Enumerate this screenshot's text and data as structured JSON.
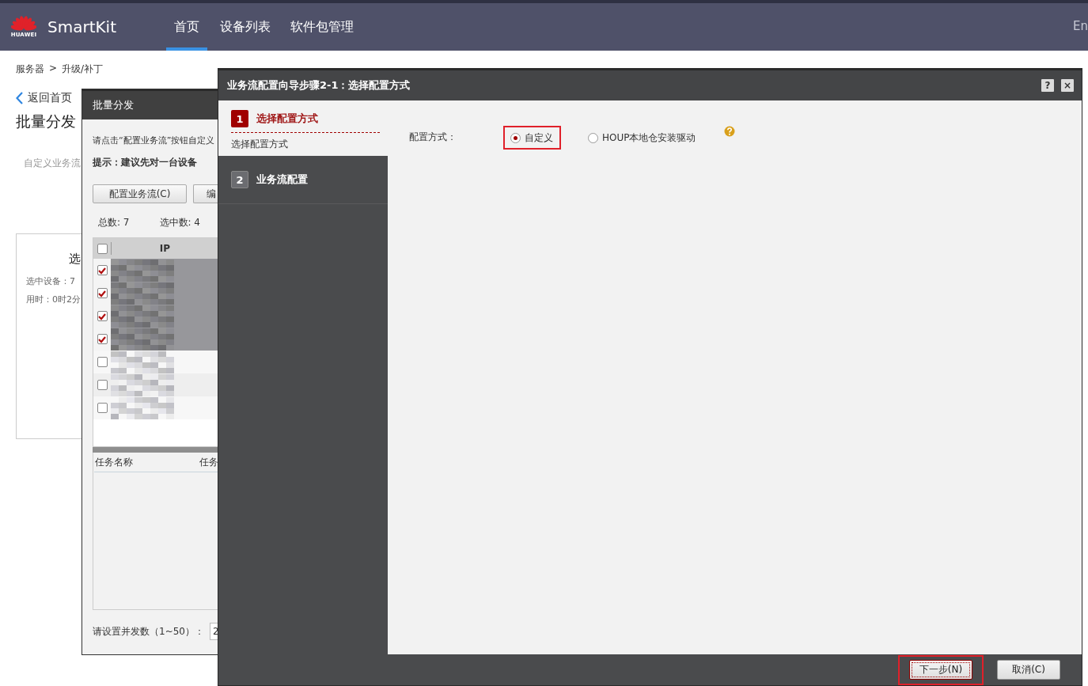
{
  "header": {
    "logo_text": "HUAWEI",
    "app_name": "SmartKit",
    "nav": [
      {
        "label": "首页",
        "selected": true
      },
      {
        "label": "设备列表",
        "selected": false
      },
      {
        "label": "软件包管理",
        "selected": false
      }
    ],
    "language": "En"
  },
  "page": {
    "breadcrumb": [
      "服务器",
      "升级/补丁"
    ],
    "breadcrumb_separator": ">",
    "back_link": "返回首页",
    "title": "批量分发",
    "description": "自定义业务流",
    "card": {
      "title": "选",
      "lines": [
        "选中设备：7",
        "用时：0时2分"
      ]
    }
  },
  "batch_dialog": {
    "title": "批量分发",
    "instruction": "请点击“配置业务流”按钮自定义",
    "hint": "提示：建议先对一台设备",
    "buttons": [
      "配置业务流(C)",
      "编"
    ],
    "total": "总数: 7",
    "selected_count": "选中数: 4",
    "device_table": {
      "columns": [
        "IP"
      ],
      "all_checked": false,
      "rows": [
        {
          "checked": true,
          "selected": true
        },
        {
          "checked": true,
          "selected": true
        },
        {
          "checked": true,
          "selected": true
        },
        {
          "checked": true,
          "selected": true
        },
        {
          "checked": false,
          "selected": false
        },
        {
          "checked": false,
          "selected": false
        },
        {
          "checked": false,
          "selected": false
        }
      ]
    },
    "task_table": {
      "columns": [
        "任务名称",
        "任务"
      ]
    },
    "concurrency_label": "请设置并发数（1~50）：",
    "concurrency_value": "2"
  },
  "wizard": {
    "title": "业务流配置向导步骤2-1：选择配置方式",
    "help_button": "?",
    "close_button": "×",
    "steps": [
      {
        "number": "1",
        "label": "选择配置方式",
        "selected": true,
        "substeps": [
          "选择配置方式"
        ]
      },
      {
        "number": "2",
        "label": "业务流配置",
        "selected": false
      }
    ],
    "field_label": "配置方式：",
    "options": [
      {
        "label": "自定义",
        "selected": true,
        "highlighted": true
      },
      {
        "label": "HOUP本地仓安装驱动",
        "selected": false,
        "highlighted": false
      }
    ],
    "buttons": [
      {
        "label": "下一步(N)",
        "kind": "primary",
        "highlighted": true
      },
      {
        "label": "取消(C)",
        "kind": "secondary",
        "highlighted": false
      }
    ]
  }
}
